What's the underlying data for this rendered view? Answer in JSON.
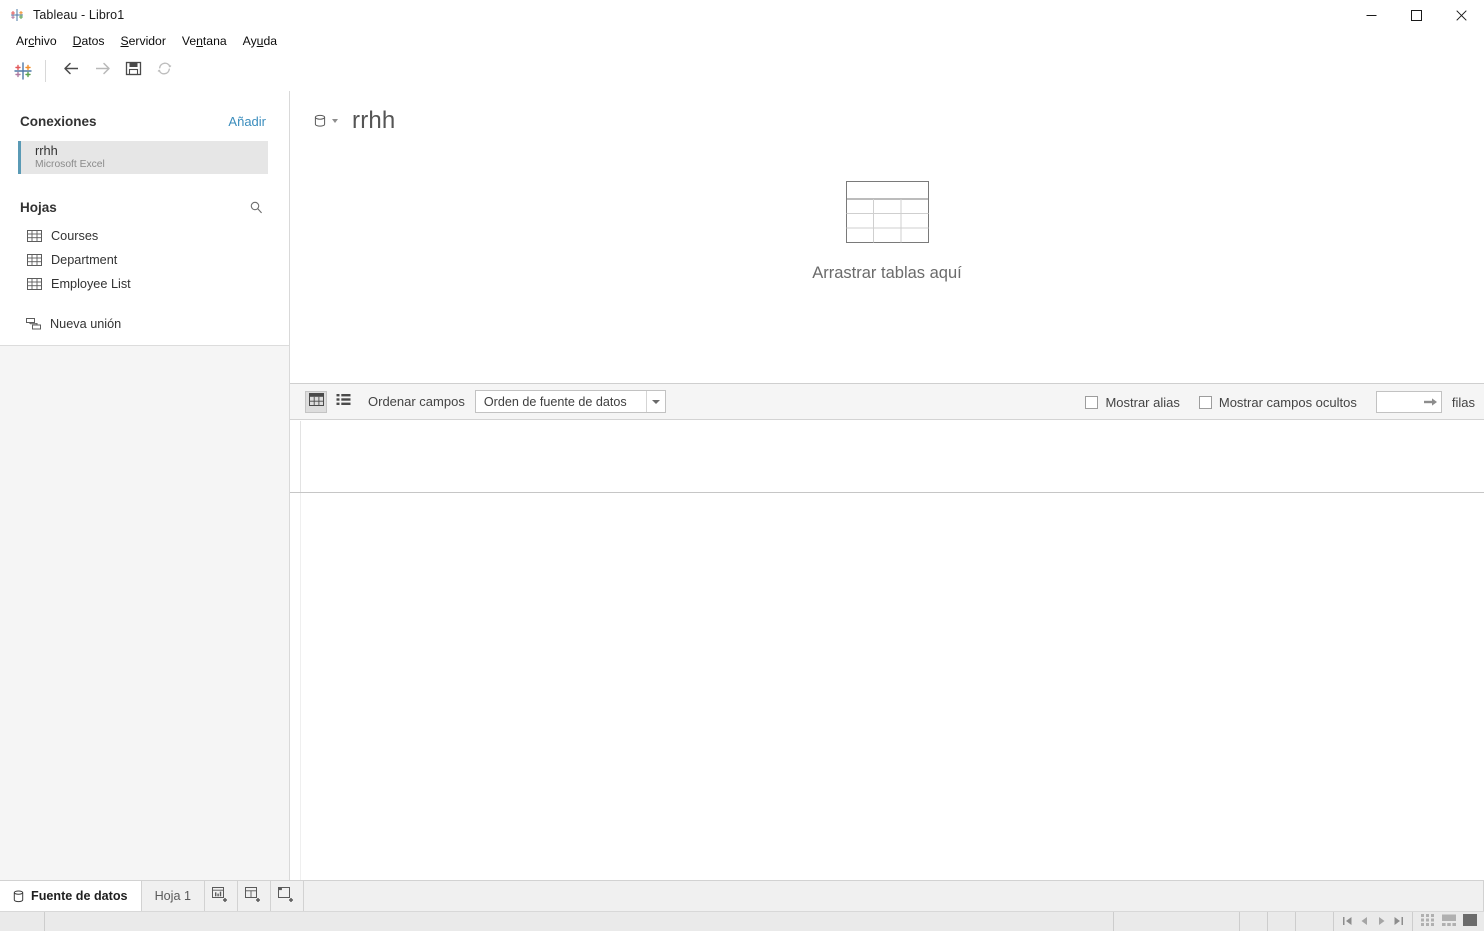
{
  "window": {
    "title": "Tableau - Libro1",
    "app_icon": "tableau-logo-icon",
    "controls": {
      "minimize": "minimize-icon",
      "maximize": "maximize-icon",
      "close": "close-icon"
    }
  },
  "menubar": {
    "items": [
      {
        "label": "Archivo",
        "pre": "Ar",
        "accel": "c",
        "post": "hivo"
      },
      {
        "label": "Datos",
        "pre": "",
        "accel": "D",
        "post": "atos"
      },
      {
        "label": "Servidor",
        "pre": "",
        "accel": "S",
        "post": "ervidor"
      },
      {
        "label": "Ventana",
        "pre": "Ve",
        "accel": "n",
        "post": "tana"
      },
      {
        "label": "Ayuda",
        "pre": "Ay",
        "accel": "u",
        "post": "da"
      }
    ]
  },
  "toolbar": {
    "logo": "tableau-logo-icon",
    "buttons": [
      {
        "name": "back-button",
        "icon": "arrow-left-icon",
        "enabled": true
      },
      {
        "name": "forward-button",
        "icon": "arrow-right-icon",
        "enabled": false
      },
      {
        "name": "save-button",
        "icon": "save-icon",
        "enabled": true
      },
      {
        "name": "refresh-button",
        "icon": "refresh-icon",
        "enabled": false
      }
    ]
  },
  "sidebar": {
    "connections": {
      "title": "Conexiones",
      "add_label": "Añadir",
      "items": [
        {
          "name": "rrhh",
          "type": "Microsoft Excel",
          "accent": "#5a9ab5",
          "selected": true
        }
      ]
    },
    "sheets": {
      "title": "Hojas",
      "search_icon": "search-icon",
      "items": [
        {
          "label": "Courses",
          "icon": "table-icon"
        },
        {
          "label": "Department",
          "icon": "table-icon"
        },
        {
          "label": "Employee List",
          "icon": "table-icon"
        }
      ],
      "new_union": {
        "label": "Nueva unión",
        "icon": "union-icon"
      }
    }
  },
  "canvas": {
    "datasource_icon": "database-icon",
    "datasource_caret": "chevron-down-icon",
    "datasource_name": "rrhh",
    "drop_zone": {
      "icon": "table-placeholder-icon",
      "text": "Arrastrar tablas aquí"
    }
  },
  "options_bar": {
    "grid_view": {
      "name": "grid-view-toggle",
      "icon": "grid-icon",
      "active": true
    },
    "list_view": {
      "name": "list-view-toggle",
      "icon": "list-icon",
      "active": false
    },
    "sort_label": "Ordenar campos",
    "sort_select": {
      "value": "Orden de fuente de datos",
      "caret": "chevron-down-icon",
      "options": [
        "Orden de fuente de datos"
      ]
    },
    "show_aliases": {
      "label": "Mostrar alias",
      "checked": false
    },
    "show_hidden": {
      "label": "Mostrar campos ocultos",
      "checked": false
    },
    "rows_input": {
      "value": "",
      "placeholder": "",
      "go_icon": "arrow-right-icon"
    },
    "rows_label": "filas"
  },
  "bottom_tabs": {
    "tabs": [
      {
        "label": "Fuente de datos",
        "icon": "datasource-icon",
        "active": true
      },
      {
        "label": "Hoja 1",
        "icon": "",
        "active": false
      }
    ],
    "buttons": [
      {
        "name": "new-worksheet-button",
        "icon": "new-worksheet-icon"
      },
      {
        "name": "new-dashboard-button",
        "icon": "new-dashboard-icon"
      },
      {
        "name": "new-story-button",
        "icon": "new-story-icon"
      }
    ]
  },
  "status_bar": {
    "nav": [
      {
        "name": "first-sheet-button",
        "icon": "nav-first-icon"
      },
      {
        "name": "prev-sheet-button",
        "icon": "nav-prev-icon"
      },
      {
        "name": "next-sheet-button",
        "icon": "nav-next-icon"
      },
      {
        "name": "last-sheet-button",
        "icon": "nav-last-icon"
      }
    ],
    "views": [
      {
        "name": "show-sheet-thumbnails-button",
        "icon": "thumbnails-icon",
        "active": false
      },
      {
        "name": "show-filmstrip-button",
        "icon": "filmstrip-icon",
        "active": false
      },
      {
        "name": "show-sheet-button",
        "icon": "sheet-icon",
        "active": true
      }
    ]
  },
  "colors": {
    "accent_blue": "#3b8dbd",
    "connection_accent": "#5a9ab5",
    "panel_bg": "#f5f5f5",
    "border": "#d9d9d9"
  }
}
